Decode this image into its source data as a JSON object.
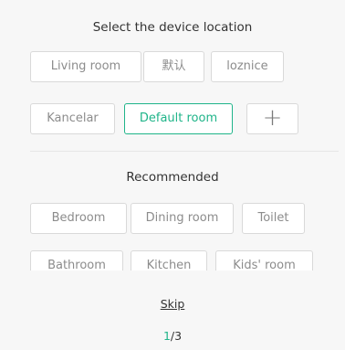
{
  "header": {
    "title": "Select the device location"
  },
  "rooms": [
    {
      "label": "Living room",
      "selected": false
    },
    {
      "label": "默认",
      "selected": false
    },
    {
      "label": "loznice",
      "selected": false
    },
    {
      "label": "Kancelar",
      "selected": false
    },
    {
      "label": "Default room",
      "selected": true
    }
  ],
  "add_button": {
    "icon": "plus-icon",
    "glyph": "+"
  },
  "recommended": {
    "title": "Recommended",
    "items": [
      "Bedroom",
      "Dining room",
      "Toilet",
      "Bathroom",
      "Kitchen",
      "Kids' room"
    ]
  },
  "footer": {
    "skip_label": "Skip",
    "page_current": "1",
    "page_total_label": "/3"
  },
  "colors": {
    "accent": "#1fb489",
    "chip_border": "#d9d9d9",
    "chip_text": "#8c8c8c",
    "background": "#f7f7f7"
  }
}
